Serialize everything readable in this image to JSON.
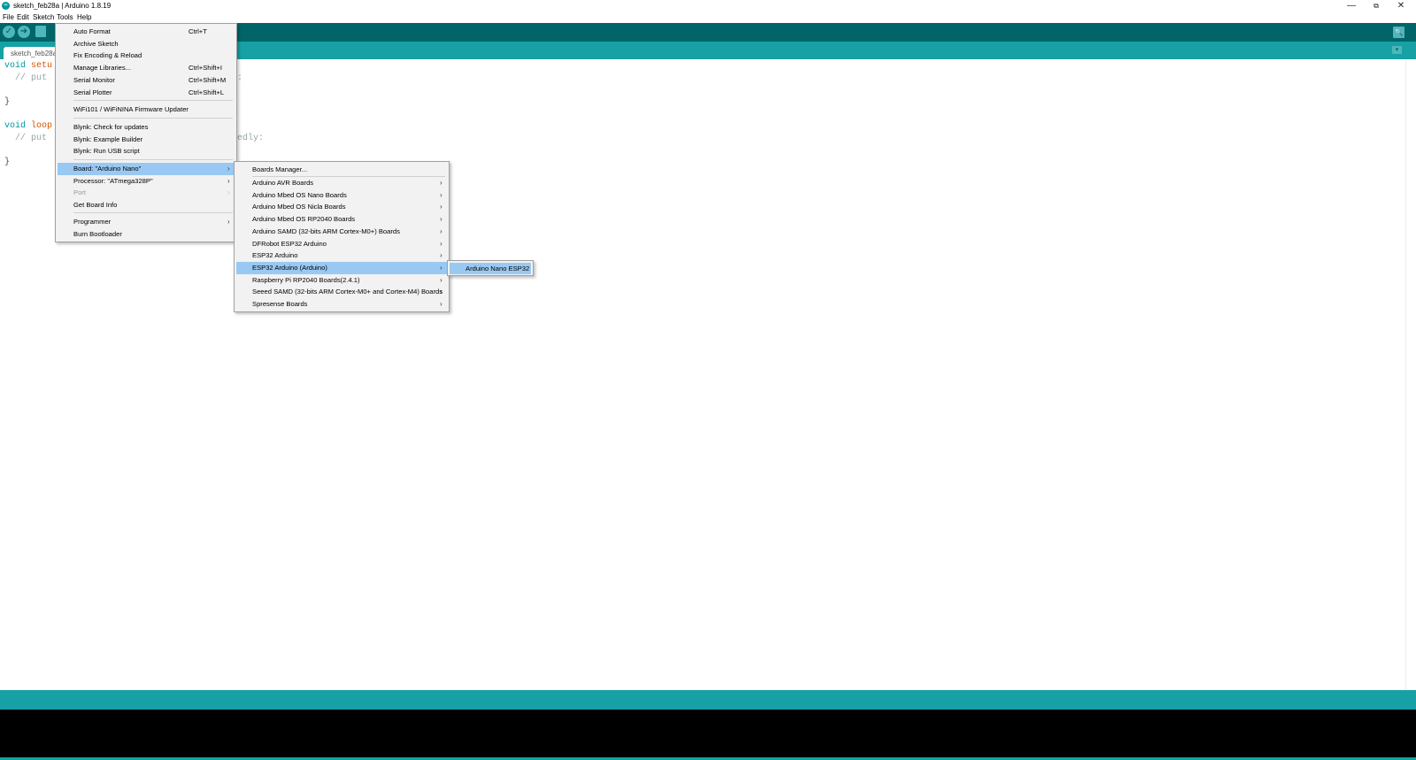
{
  "window": {
    "title": "sketch_feb28a | Arduino 1.8.19",
    "app_icon": "arduino-icon",
    "controls": {
      "minimize": "—",
      "maximize": "⧉",
      "close": "✕"
    }
  },
  "menubar": {
    "items": [
      "File",
      "Edit",
      "Sketch",
      "Tools",
      "Help"
    ]
  },
  "toolbar": {
    "buttons": [
      {
        "name": "verify-icon",
        "glyph": "✓"
      },
      {
        "name": "upload-icon",
        "glyph": "➜"
      },
      {
        "name": "new-icon",
        "glyph": "▤"
      }
    ],
    "serial_monitor_icon": "🔍"
  },
  "tabs": {
    "sketch_tab": "sketch_feb28a",
    "tab_menu_icon": "▾"
  },
  "editor": {
    "lines": [
      {
        "kw": "void",
        "fn": "setu",
        "rest": ""
      },
      {
        "cm": "  // put",
        "tail": ":"
      },
      {
        "text": ""
      },
      {
        "text": "}"
      },
      {
        "text": ""
      },
      {
        "kw": "void",
        "fn": "loop",
        "rest": ""
      },
      {
        "cm": "  // put",
        "tail": "tedly:"
      },
      {
        "text": ""
      },
      {
        "text": "}"
      }
    ]
  },
  "tools_menu": {
    "items": [
      {
        "label": "Auto Format",
        "shortcut": "Ctrl+T"
      },
      {
        "label": "Archive Sketch",
        "shortcut": ""
      },
      {
        "label": "Fix Encoding & Reload",
        "shortcut": ""
      },
      {
        "label": "Manage Libraries...",
        "shortcut": "Ctrl+Shift+I"
      },
      {
        "label": "Serial Monitor",
        "shortcut": "Ctrl+Shift+M"
      },
      {
        "label": "Serial Plotter",
        "shortcut": "Ctrl+Shift+L"
      },
      {
        "label": "WiFi101 / WiFiNINA Firmware Updater",
        "shortcut": ""
      },
      {
        "label": "Blynk: Check for updates",
        "shortcut": ""
      },
      {
        "label": "Blynk: Example Builder",
        "shortcut": ""
      },
      {
        "label": "Blynk: Run USB script",
        "shortcut": ""
      },
      {
        "label": "Board: \"Arduino Nano\"",
        "shortcut": ""
      },
      {
        "label": "Processor: \"ATmega328P\"",
        "shortcut": ""
      },
      {
        "label": "Port",
        "shortcut": ""
      },
      {
        "label": "Get Board Info",
        "shortcut": ""
      },
      {
        "label": "Programmer",
        "shortcut": ""
      },
      {
        "label": "Burn Bootloader",
        "shortcut": ""
      }
    ],
    "highlighted": "Board: \"Arduino Nano\"",
    "disabled": [
      "Port"
    ]
  },
  "board_submenu": {
    "items": [
      "Boards Manager...",
      "Arduino AVR Boards",
      "Arduino Mbed OS Nano Boards",
      "Arduino Mbed OS Nicla Boards",
      "Arduino Mbed OS RP2040 Boards",
      "Arduino SAMD (32-bits ARM Cortex-M0+) Boards",
      "DFRobot ESP32 Arduino",
      "ESP32 Arduino",
      "ESP32 Arduino (Arduino)",
      "Raspberry Pi RP2040 Boards(2.4.1)",
      "Seeed SAMD (32-bits ARM Cortex-M0+ and Cortex-M4) Boards",
      "Spresense Boards"
    ],
    "highlighted": "ESP32 Arduino (Arduino)"
  },
  "esp32_submenu": {
    "items": [
      "Arduino Nano ESP32"
    ],
    "highlighted": "Arduino Nano ESP32"
  },
  "submenu_arrow": "›",
  "colors": {
    "toolbar": "#006468",
    "tabstrip": "#17a1a5",
    "highlight": "#99c9f2",
    "console": "#000000"
  }
}
